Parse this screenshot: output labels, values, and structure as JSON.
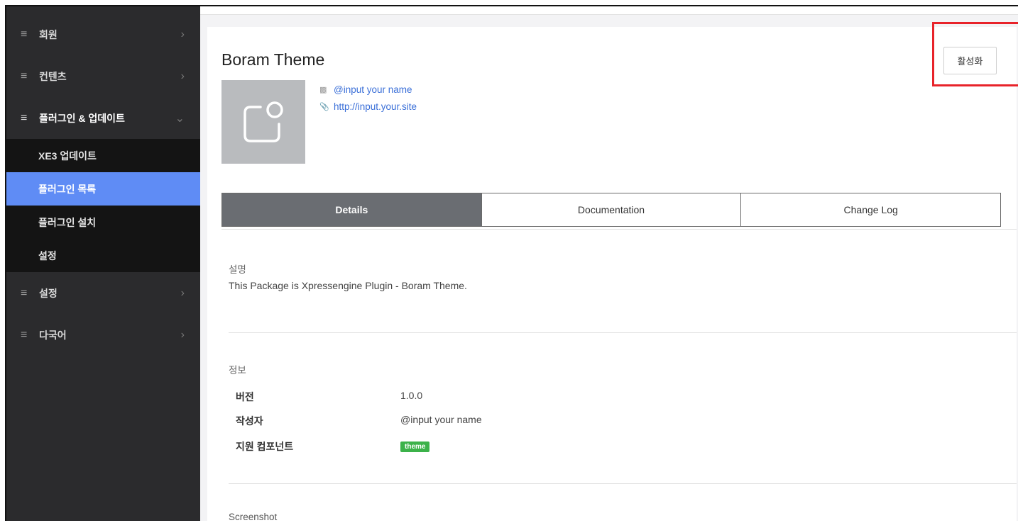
{
  "sidebar": {
    "items": [
      {
        "label": "회원",
        "chevron": "›"
      },
      {
        "label": "컨텐츠",
        "chevron": "›"
      },
      {
        "label": "플러그인 & 업데이트",
        "chevron": "⌄"
      },
      {
        "label": "설정",
        "chevron": "›"
      },
      {
        "label": "다국어",
        "chevron": "›"
      }
    ],
    "subitems": [
      {
        "label": "XE3 업데이트"
      },
      {
        "label": "플러그인 목록"
      },
      {
        "label": "플러그인 설치"
      },
      {
        "label": "설정"
      }
    ]
  },
  "plugin": {
    "title": "Boram Theme",
    "activate_label": "활성화",
    "author_link": "@input your name",
    "site_link": "http://input.your.site"
  },
  "tabs": [
    {
      "label": "Details"
    },
    {
      "label": "Documentation"
    },
    {
      "label": "Change Log"
    }
  ],
  "details": {
    "description_title": "설명",
    "description": "This Package is Xpressengine Plugin - Boram Theme.",
    "info_title": "정보",
    "info": [
      {
        "key": "버전",
        "value": "1.0.0"
      },
      {
        "key": "작성자",
        "value": "@input your name"
      },
      {
        "key": "지원 컴포넌트",
        "value": "theme"
      }
    ],
    "screenshot_title": "Screenshot"
  },
  "colors": {
    "sidebar_bg": "#2b2b2d",
    "active_item": "#5f8cf5",
    "active_tab": "#6a6d72",
    "badge": "#3cb24a",
    "highlight": "#e8232a",
    "link": "#3a6fd8"
  }
}
